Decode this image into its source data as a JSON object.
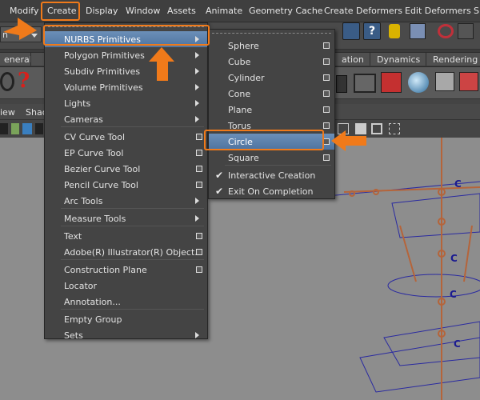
{
  "menubar": {
    "items": [
      {
        "label": "Modify"
      },
      {
        "label": "Create"
      },
      {
        "label": "Display"
      },
      {
        "label": "Window"
      },
      {
        "label": "Assets"
      },
      {
        "label": "Animate"
      },
      {
        "label": "Geometry Cache"
      },
      {
        "label": "Create Deformers"
      },
      {
        "label": "Edit Deformers"
      },
      {
        "label": "S"
      }
    ]
  },
  "background": {
    "mode_selector": "n",
    "tabs": [
      {
        "label": "eneral"
      },
      {
        "label": "ation"
      },
      {
        "label": "Dynamics"
      },
      {
        "label": "Rendering"
      }
    ],
    "panel_menu": [
      {
        "label": "iew"
      },
      {
        "label": "Shad"
      }
    ],
    "viewport_label": "C"
  },
  "create_menu": {
    "items": [
      {
        "label": "NURBS Primitives",
        "kind": "submenu",
        "highlighted": true
      },
      {
        "label": "Polygon Primitives",
        "kind": "submenu"
      },
      {
        "label": "Subdiv Primitives",
        "kind": "submenu"
      },
      {
        "label": "Volume Primitives",
        "kind": "submenu"
      },
      {
        "label": "Lights",
        "kind": "submenu"
      },
      {
        "label": "Cameras",
        "kind": "submenu"
      },
      {
        "label": "CV Curve Tool",
        "kind": "option"
      },
      {
        "label": "EP Curve Tool",
        "kind": "option"
      },
      {
        "label": "Bezier Curve Tool",
        "kind": "option"
      },
      {
        "label": "Pencil Curve Tool",
        "kind": "option"
      },
      {
        "label": "Arc Tools",
        "kind": "submenu"
      },
      {
        "label": "Measure Tools",
        "kind": "submenu"
      },
      {
        "label": "Text",
        "kind": "option"
      },
      {
        "label": "Adobe(R) Illustrator(R) Object...",
        "kind": "option"
      },
      {
        "label": "Construction Plane",
        "kind": "option"
      },
      {
        "label": "Locator",
        "kind": "plain"
      },
      {
        "label": "Annotation...",
        "kind": "plain"
      },
      {
        "label": "Empty Group",
        "kind": "plain"
      },
      {
        "label": "Sets",
        "kind": "submenu"
      }
    ]
  },
  "nurbs_submenu": {
    "items": [
      {
        "label": "Sphere",
        "kind": "option"
      },
      {
        "label": "Cube",
        "kind": "option"
      },
      {
        "label": "Cylinder",
        "kind": "option"
      },
      {
        "label": "Cone",
        "kind": "option"
      },
      {
        "label": "Plane",
        "kind": "option"
      },
      {
        "label": "Torus",
        "kind": "option"
      },
      {
        "label": "Circle",
        "kind": "option",
        "highlighted": true
      },
      {
        "label": "Square",
        "kind": "option"
      },
      {
        "label": "Interactive Creation",
        "kind": "check",
        "checked": true
      },
      {
        "label": "Exit On Completion",
        "kind": "check",
        "checked": true
      }
    ]
  },
  "colors": {
    "highlight": "#5a80ad",
    "annotation_orange": "#f07a1a",
    "menu_bg": "#444444"
  }
}
